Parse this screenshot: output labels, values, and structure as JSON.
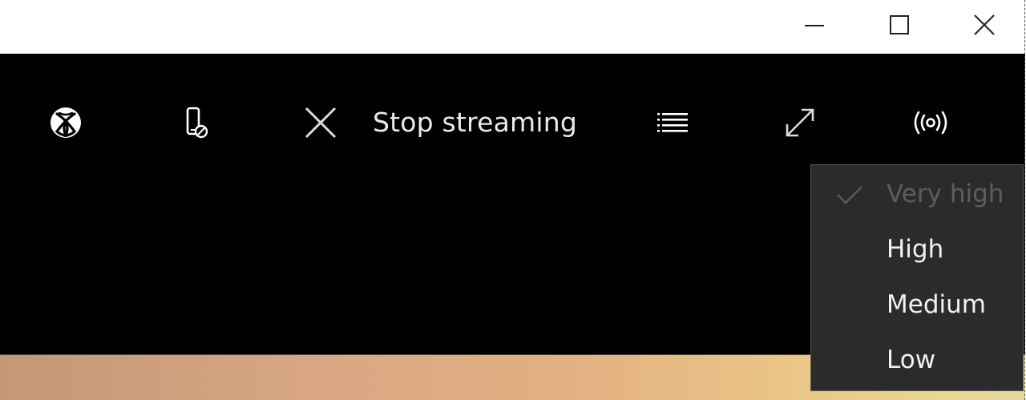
{
  "titlebar": {
    "buttons": [
      {
        "name": "minimize",
        "icon": "minimize-icon"
      },
      {
        "name": "maximize",
        "icon": "maximize-icon"
      },
      {
        "name": "close",
        "icon": "close-icon"
      }
    ]
  },
  "toolbar": {
    "xbox_icon": "xbox-logo-icon",
    "mic_icon": "device-mute-icon",
    "stop_icon": "x-icon",
    "stop_label": "Stop streaming",
    "list_icon": "list-icon",
    "fullscreen_icon": "expand-diagonal-icon",
    "bandwidth_icon": "broadcast-icon"
  },
  "quality_menu": {
    "items": [
      {
        "label": "Very high",
        "checked": true,
        "disabled": true
      },
      {
        "label": "High",
        "checked": false,
        "disabled": false
      },
      {
        "label": "Medium",
        "checked": false,
        "disabled": false
      },
      {
        "label": "Low",
        "checked": false,
        "disabled": false
      }
    ]
  },
  "colors": {
    "titlebar_bg": "#ffffff",
    "stream_bg": "#000000",
    "menu_bg": "#2b2b2b",
    "menu_text": "#f2f2f2",
    "menu_disabled_text": "#5d5d5d"
  }
}
